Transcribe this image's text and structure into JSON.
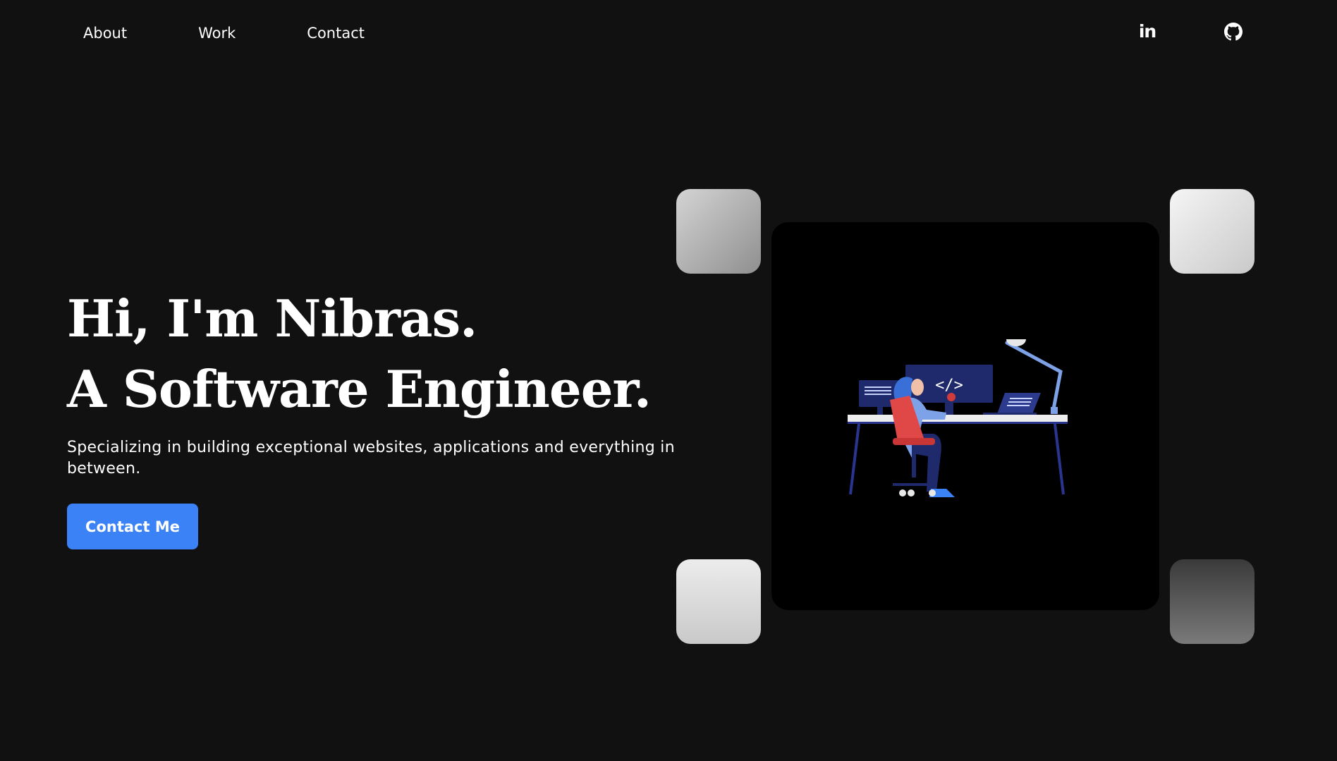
{
  "nav": {
    "links": [
      {
        "label": "About"
      },
      {
        "label": "Work"
      },
      {
        "label": "Contact"
      }
    ],
    "social": [
      {
        "icon": "linkedin-icon"
      },
      {
        "icon": "github-icon"
      }
    ]
  },
  "hero": {
    "title_line1": "Hi, I'm Nibras.",
    "title_line2": "A Software Engineer.",
    "subtitle": "Specializing in building exceptional websites, applications and everything in between.",
    "cta_label": "Contact Me"
  },
  "illustration": {
    "icon": "developer-at-desk-illustration",
    "code_glyph": "</>"
  },
  "colors": {
    "background": "#111111",
    "accent": "#3b82f6",
    "text": "#ffffff",
    "card": "#000000"
  }
}
